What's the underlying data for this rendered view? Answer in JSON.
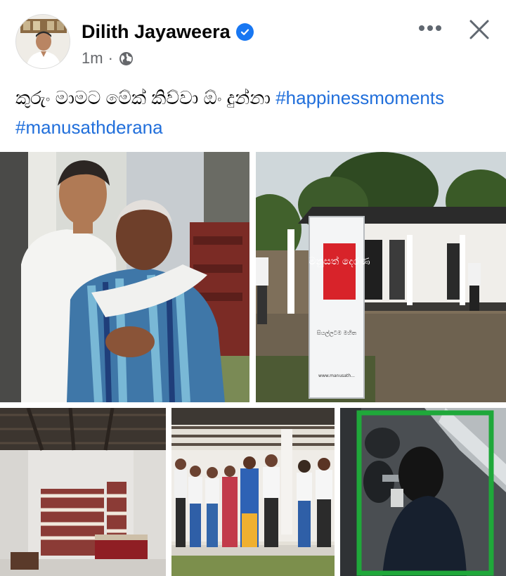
{
  "post": {
    "author_name": "Dilith Jayaweera",
    "timestamp": "1m",
    "separator": "·",
    "audience_icon": "globe-icon",
    "verified_icon": "verified-badge-icon",
    "caption_text": "කුරුං මාමට මේක් කිව්වා ඕං දුන්නා ",
    "hashtags": [
      "#happinessmoments",
      "#manusathderana"
    ]
  },
  "header_actions": {
    "more_icon": "more-horizontal-icon",
    "close_icon": "close-icon"
  },
  "photos": {
    "banner_text": "මනුසත් දෙරණ",
    "banner_subtext": "සියල්ලටම මහිත",
    "banner_url": "www.manusath..."
  },
  "colors": {
    "link": "#216fdb",
    "verified": "#1877f2",
    "highlight_border": "#1fa83a",
    "muted_text": "#65676b"
  }
}
